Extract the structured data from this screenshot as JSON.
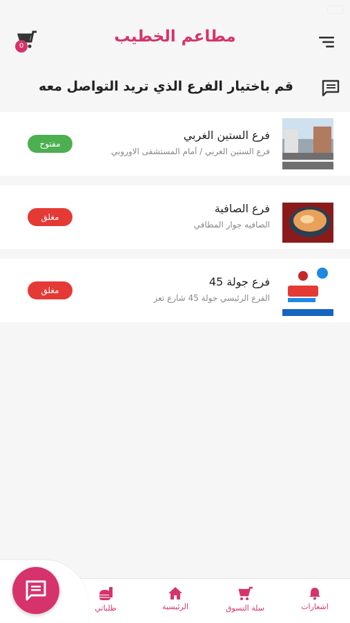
{
  "header": {
    "title": "مطاعم الخطيب",
    "cart_count": "0"
  },
  "prompt": {
    "text": "قم باختيار الفرع الذي تريد التواصل معه"
  },
  "branches": [
    {
      "name": "فرع الستين الغربي",
      "address": "فرع الستين الغربي / أمام المستشفى الاوروبي",
      "status": "مفتوح",
      "status_color": "#4caf50"
    },
    {
      "name": "فرع الصافية",
      "address": "الصافيه جوار المطافي",
      "status": "مغلق",
      "status_color": "#e53935"
    },
    {
      "name": "فرع جولة 45",
      "address": "الفرع الرئيسي جولة 45 شارع تعز",
      "status": "مغلق",
      "status_color": "#e53935"
    }
  ],
  "nav": {
    "notifications": "اشعارات",
    "cart": "سلة التسوق",
    "home": "الرئيسية",
    "orders": "طلباتي"
  },
  "colors": {
    "brand": "#d6336c",
    "open": "#4caf50",
    "closed": "#e53935"
  }
}
